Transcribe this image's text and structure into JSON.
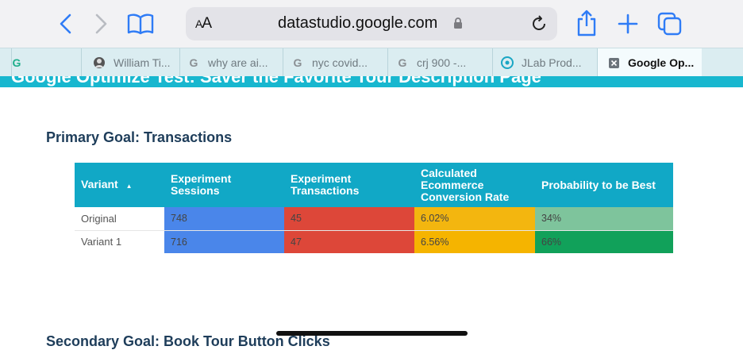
{
  "browser": {
    "url": "datastudio.google.com",
    "text_size_label": "AA"
  },
  "tabs": [
    {
      "label": "",
      "icon": "grammarly-icon"
    },
    {
      "label": "William Ti...",
      "icon": "profile-icon"
    },
    {
      "label": "why are ai...",
      "icon": "google-icon"
    },
    {
      "label": "nyc covid...",
      "icon": "google-icon"
    },
    {
      "label": "crj 900 -...",
      "icon": "google-icon"
    },
    {
      "label": "JLab Prod...",
      "icon": "jlab-icon"
    },
    {
      "label": "Google Op...",
      "icon": "close-icon",
      "active": true
    }
  ],
  "page": {
    "header_title": "Google Optimize Test: Saver the Favorite Tour Description Page",
    "primary_goal_title": "Primary Goal: Transactions",
    "secondary_goal_title": "Secondary Goal: Book Tour Button Clicks"
  },
  "table": {
    "headers": [
      "Variant",
      "Experiment Sessions",
      "Experiment Transactions",
      "Calculated Ecommerce Conversion Rate",
      "Probability to be Best"
    ],
    "sort_indicator": "▲",
    "rows": [
      {
        "variant": "Original",
        "sessions": "748",
        "transactions": "45",
        "conversion_rate": "6.02%",
        "probability": "34%"
      },
      {
        "variant": "Variant 1",
        "sessions": "716",
        "transactions": "47",
        "conversion_rate": "6.56%",
        "probability": "66%"
      }
    ]
  },
  "colors": {
    "accent": "#2f7cf6",
    "header_band": "#18b7cf",
    "table_header": "#11a8c6",
    "sessions": "#4a86ea",
    "transactions": "#dd4739",
    "conversion": "#f3b60f",
    "probability_low": "#7ec49c",
    "probability_high": "#11a15a"
  }
}
